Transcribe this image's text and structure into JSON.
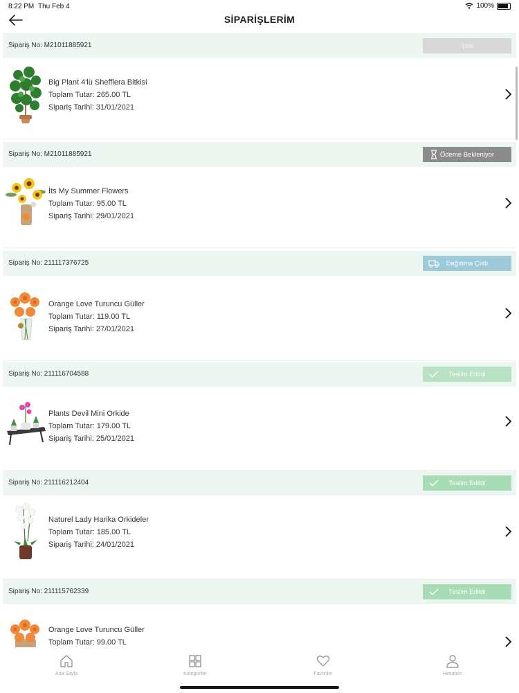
{
  "status_bar": {
    "time": "8:22 PM",
    "date": "Thu Feb 4",
    "battery": "100%"
  },
  "header": {
    "title": "SİPARİŞLERİM"
  },
  "orders": [
    {
      "order_no": "Sipariş No: M21011885921",
      "status": "İptal",
      "product": "Big Plant 4'lü Shefflera Bitkisi",
      "total": "Toplam Tutar: 265.00 TL",
      "date": "Sipariş Tarihi: 31/01/2021"
    },
    {
      "order_no": "Sipariş No: M21011885921",
      "status": "Ödeme Bekleniyor",
      "product": "İts My Summer Flowers",
      "total": "Toplam Tutar: 95.00 TL",
      "date": "Sipariş Tarihi: 29/01/2021"
    },
    {
      "order_no": "Sipariş No: 211117376725",
      "status": "Dağıtıma Çıktı",
      "product": "Orange Love Turuncu Güller",
      "total": "Toplam Tutar: 119.00 TL",
      "date": "Sipariş Tarihi: 27/01/2021"
    },
    {
      "order_no": "Sipariş No: 211116704588",
      "status": "Teslim Edildi",
      "product": "Plants Devil Mini Orkide",
      "total": "Toplam Tutar: 179.00 TL",
      "date": "Sipariş Tarihi: 25/01/2021"
    },
    {
      "order_no": "Sipariş No: 211116212404",
      "status": "Teslim Edildi",
      "product": "Naturel Lady Harika Orkideler",
      "total": "Toplam Tutar: 185.00 TL",
      "date": "Sipariş Tarihi: 24/01/2021"
    },
    {
      "order_no": "Sipariş No: 211115762339",
      "status": "Teslim Edildi",
      "product": "Orange Love Turuncu Güller",
      "total": "Toplam Tutar: 99.00 TL",
      "date": ""
    }
  ],
  "tab_bar": {
    "home": "Ana Sayfa",
    "categories": "Kategoriler",
    "favorites": "Favoriler",
    "account": "Hesabım"
  },
  "colors": {
    "header_bg": "#eef6f1",
    "cancelled": "#d8d8d8",
    "pending": "#8b8b8b",
    "shipped": "#9ccadb",
    "delivered": "#a7dcb6"
  }
}
